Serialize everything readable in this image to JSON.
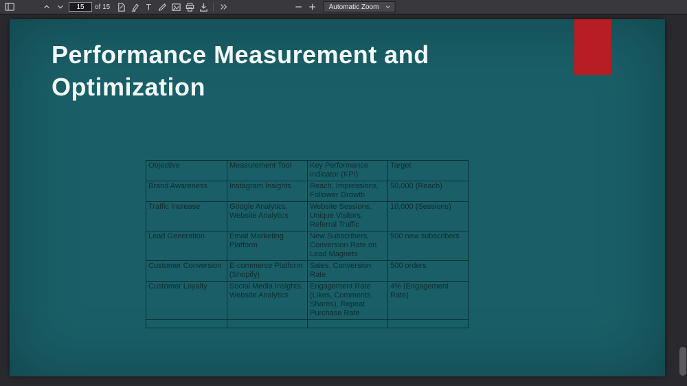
{
  "toolbar": {
    "page_value": "15",
    "page_of": "of 15",
    "zoom_label": "Automatic Zoom",
    "icons": {
      "left": [
        "sidebar-toggle",
        "page-up",
        "page-down"
      ],
      "center": [
        "zoom-out",
        "zoom-in",
        "zoom-dropdown-chevron"
      ],
      "right": [
        "edit",
        "highlight",
        "free-text",
        "draw",
        "image",
        "print",
        "save",
        "more-tools"
      ]
    }
  },
  "slide": {
    "title": "Performance Measurement and Optimization",
    "accent_color": "#b71d22",
    "background_color": "#1a5f67",
    "table": {
      "headers": [
        "Objective",
        "Measurement Tool",
        "Key Performance Indicator (KPI)",
        "Target"
      ],
      "rows": [
        [
          "Brand Awareness",
          "Instagram Insights",
          "Reach, Impressions, Follower Growth",
          "50,000 (Reach)"
        ],
        [
          "Traffic Increase",
          "Google Analytics, Website Analytics",
          "Website Sessions, Unique Visitors, Referral Traffic",
          "10,000 (Sessions)"
        ],
        [
          "Lead Generation",
          "Email Marketing Platform",
          "New Subscribers, Conversion Rate on Lead Magnets",
          "500 new subscribers"
        ],
        [
          "Customer Conversion",
          "E-commerce Platform (Shopify)",
          "Sales, Conversion Rate",
          "500 orders"
        ],
        [
          "Customer Loyalty",
          "Social Media Insights, Website Analytics",
          "Engagement Rate (Likes, Comments, Shares), Repeat Purchase Rate",
          "4% (Engagement Rate)"
        ],
        [
          "",
          "",
          "",
          ""
        ]
      ]
    }
  }
}
